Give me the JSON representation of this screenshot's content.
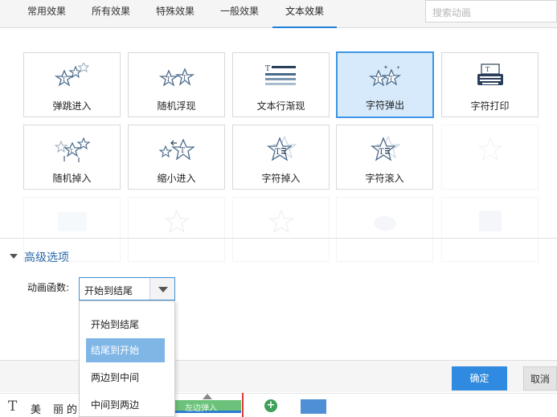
{
  "tabs": [
    {
      "label": "常用效果",
      "active": false
    },
    {
      "label": "所有效果",
      "active": false
    },
    {
      "label": "特殊效果",
      "active": false
    },
    {
      "label": "一般效果",
      "active": false
    },
    {
      "label": "文本效果",
      "active": true
    }
  ],
  "search": {
    "placeholder": "搜索动画"
  },
  "effects": [
    {
      "label": "弹跳进入",
      "icon": "bouncing-stars-icon"
    },
    {
      "label": "随机浮现",
      "icon": "twin-stars-icon"
    },
    {
      "label": "文本行渐现",
      "icon": "text-lines-icon"
    },
    {
      "label": "字符弹出",
      "icon": "sparkle-stars-icon",
      "selected": true
    },
    {
      "label": "字符打印",
      "icon": "typewriter-icon"
    },
    {
      "label": "随机掉入",
      "icon": "falling-stars-icon"
    },
    {
      "label": "缩小进入",
      "icon": "shrink-stars-icon"
    },
    {
      "label": "字符掉入",
      "icon": "star-text-icon"
    },
    {
      "label": "字符滚入",
      "icon": "rolling-star-icon"
    }
  ],
  "advanced": {
    "title": "高级选项",
    "function_label": "动画函数:",
    "selected": "开始到结尾",
    "options": [
      "开始到结尾",
      "结尾到开始",
      "两边到中间",
      "中间到两边"
    ],
    "highlighted_index": 1
  },
  "footer": {
    "ok_label": "确定",
    "cancel_label": "取消"
  },
  "timeline": {
    "chars": [
      "美",
      "丽",
      "的"
    ],
    "clip_label": "左边弹入"
  },
  "colors": {
    "accent": "#2f8ae0",
    "selected_bg": "#d6eafb",
    "timeline_clip": "#6cc27a"
  }
}
